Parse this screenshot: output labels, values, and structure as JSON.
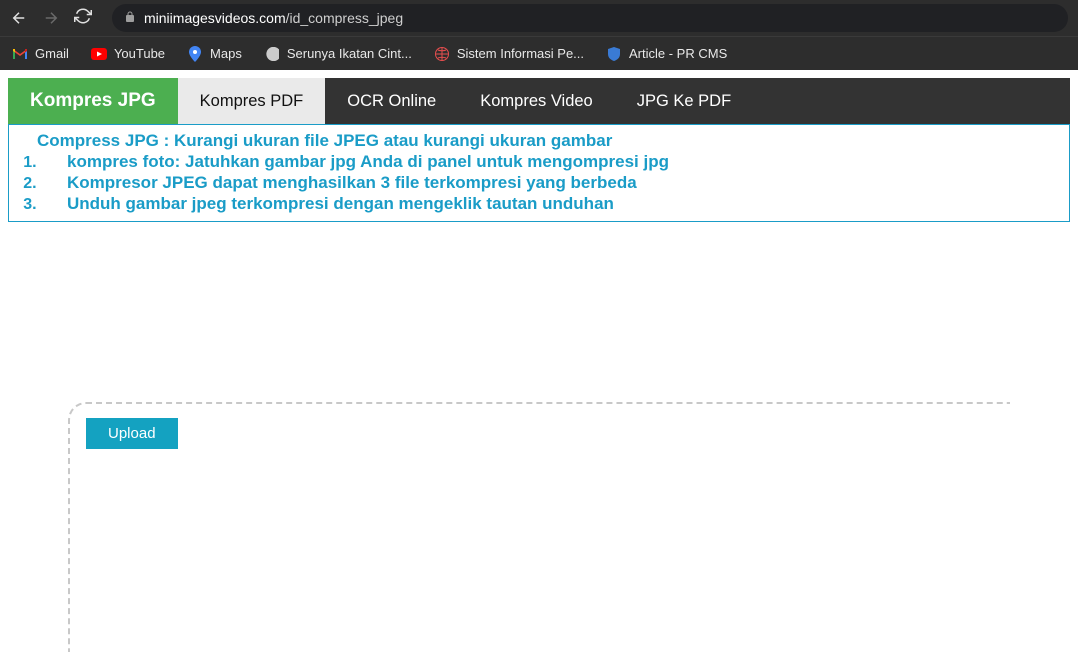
{
  "browser": {
    "url_domain": "miniimagesvideos.com",
    "url_path": "/id_compress_jpeg"
  },
  "bookmarks": [
    {
      "label": "Gmail"
    },
    {
      "label": "YouTube"
    },
    {
      "label": "Maps"
    },
    {
      "label": "Serunya Ikatan Cint..."
    },
    {
      "label": "Sistem Informasi Pe..."
    },
    {
      "label": "Article - PR CMS"
    }
  ],
  "nav": {
    "items": [
      {
        "label": "Kompres JPG"
      },
      {
        "label": "Kompres PDF"
      },
      {
        "label": "OCR Online"
      },
      {
        "label": "Kompres Video"
      },
      {
        "label": "JPG Ke PDF"
      }
    ]
  },
  "info": {
    "title": "Compress JPG : Kurangi ukuran file JPEG atau kurangi ukuran gambar",
    "items": [
      "kompres foto: Jatuhkan gambar jpg Anda di panel untuk mengompresi jpg",
      "Kompresor JPEG dapat menghasilkan 3 file terkompresi yang berbeda",
      "Unduh gambar jpeg terkompresi dengan mengeklik tautan unduhan"
    ]
  },
  "upload": {
    "button": "Upload"
  }
}
